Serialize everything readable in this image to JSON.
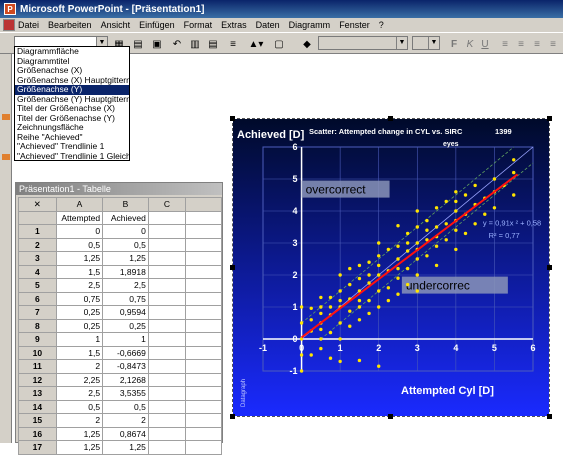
{
  "window": {
    "title": "Microsoft PowerPoint - [Präsentation1]"
  },
  "menu": [
    "Datei",
    "Bearbeiten",
    "Ansicht",
    "Einfügen",
    "Format",
    "Extras",
    "Daten",
    "Diagramm",
    "Fenster",
    "?"
  ],
  "toolbar": {
    "font_buttons": [
      "F",
      "K",
      "U"
    ],
    "element_combo_value": ""
  },
  "dropdown": {
    "options": [
      "Diagrammfläche",
      "Diagrammtitel",
      "Größenachse (X)",
      "Größenachse (X) Hauptgitternetz",
      "Größenachse (Y)",
      "Größenachse (Y) Hauptgitternetz",
      "Titel der Größenachse (X)",
      "Titel der Größenachse (Y)",
      "Zeichnungsfläche",
      "Reihe \"Achieved\"",
      "\"Achieved\" Trendlinie 1",
      "\"Achieved\" Trendlinie 1 Gleichung"
    ],
    "selected_index": 4
  },
  "datasheet": {
    "title": "Präsentation1 - Tabelle",
    "columns": [
      "A",
      "B",
      "C"
    ],
    "header_row": [
      "Attempted",
      "Achieved",
      "",
      ""
    ],
    "rows": [
      [
        "1",
        "0",
        "0"
      ],
      [
        "2",
        "0,5",
        "0,5"
      ],
      [
        "3",
        "1,25",
        "1,25"
      ],
      [
        "4",
        "1,5",
        "1,8918"
      ],
      [
        "5",
        "2,5",
        "2,5"
      ],
      [
        "6",
        "0,75",
        "0,75"
      ],
      [
        "7",
        "0,25",
        "0,9594"
      ],
      [
        "8",
        "0,25",
        "0,25"
      ],
      [
        "9",
        "1",
        "1"
      ],
      [
        "10",
        "1,5",
        "-0,6669"
      ],
      [
        "11",
        "2",
        "-0,8473"
      ],
      [
        "12",
        "2,25",
        "2,1268"
      ],
      [
        "13",
        "2,5",
        "3,5355"
      ],
      [
        "14",
        "0,5",
        "0,5"
      ],
      [
        "15",
        "2",
        "2"
      ],
      [
        "16",
        "1,25",
        "0,8674"
      ],
      [
        "17",
        "1,25",
        "1,25"
      ]
    ]
  },
  "chart_data": {
    "type": "scatter",
    "title": "Scatter: Attempted change in CYL vs. SIRC",
    "title_count": "1399",
    "title_unit": "eyes",
    "xlabel": "Attempted Cyl [D]",
    "ylabel": "Achieved [D]",
    "xlim": [
      -1,
      6
    ],
    "ylim": [
      -1,
      6
    ],
    "x_ticks": [
      "-1",
      "0",
      "1",
      "2",
      "3",
      "4",
      "5",
      "6"
    ],
    "y_ticks": [
      "-1",
      "0",
      "1",
      "2",
      "3",
      "4",
      "5",
      "6"
    ],
    "grid": true,
    "annotations": {
      "overcorrect": "overcorrect",
      "undercorrect": "undercorrec",
      "equation": "y = 0,91x    ² + 0,58",
      "r2": "R² = 0,77",
      "brand": "Datagraph"
    },
    "trendline": {
      "slope": 0.91,
      "intercept": 0.05,
      "x_range": [
        0,
        5.6
      ]
    },
    "series": [
      {
        "name": "Achieved",
        "points": [
          [
            0,
            0
          ],
          [
            0,
            -0.5
          ],
          [
            0,
            0.5
          ],
          [
            0,
            1
          ],
          [
            0,
            -1
          ],
          [
            0.25,
            0.25
          ],
          [
            0.25,
            0.96
          ],
          [
            0.25,
            -0.5
          ],
          [
            0.25,
            0.6
          ],
          [
            0.5,
            0.5
          ],
          [
            0.5,
            0
          ],
          [
            0.5,
            1
          ],
          [
            0.5,
            -0.3
          ],
          [
            0.5,
            0.8
          ],
          [
            0.5,
            1.3
          ],
          [
            0.75,
            0.75
          ],
          [
            0.75,
            0.2
          ],
          [
            0.75,
            1.3
          ],
          [
            0.75,
            -0.6
          ],
          [
            1,
            1
          ],
          [
            1,
            0.5
          ],
          [
            1,
            1.5
          ],
          [
            1,
            0
          ],
          [
            1,
            2
          ],
          [
            1,
            -0.7
          ],
          [
            1.25,
            1.25
          ],
          [
            1.25,
            0.87
          ],
          [
            1.25,
            1.7
          ],
          [
            1.25,
            0.4
          ],
          [
            1.25,
            2.2
          ],
          [
            1.5,
            1.89
          ],
          [
            1.5,
            -0.67
          ],
          [
            1.5,
            1.5
          ],
          [
            1.5,
            1
          ],
          [
            1.5,
            2.3
          ],
          [
            1.5,
            0.6
          ],
          [
            1.75,
            1.75
          ],
          [
            1.75,
            1.2
          ],
          [
            1.75,
            2.4
          ],
          [
            1.75,
            0.8
          ],
          [
            2,
            2
          ],
          [
            2,
            -0.85
          ],
          [
            2,
            1.5
          ],
          [
            2,
            2.6
          ],
          [
            2,
            1
          ],
          [
            2,
            3
          ],
          [
            2.25,
            2.13
          ],
          [
            2.25,
            1.6
          ],
          [
            2.25,
            2.8
          ],
          [
            2.25,
            1.2
          ],
          [
            2.5,
            2.5
          ],
          [
            2.5,
            3.54
          ],
          [
            2.5,
            1.9
          ],
          [
            2.5,
            2.9
          ],
          [
            2.5,
            1.4
          ],
          [
            2.75,
            2.75
          ],
          [
            2.75,
            2.2
          ],
          [
            2.75,
            3.3
          ],
          [
            2.75,
            1.7
          ],
          [
            3,
            3
          ],
          [
            3,
            2.5
          ],
          [
            3,
            3.5
          ],
          [
            3,
            2
          ],
          [
            3,
            4
          ],
          [
            3,
            1.5
          ],
          [
            3.25,
            3.1
          ],
          [
            3.25,
            2.6
          ],
          [
            3.25,
            3.7
          ],
          [
            3.5,
            3.5
          ],
          [
            3.5,
            2.9
          ],
          [
            3.5,
            4.1
          ],
          [
            3.5,
            2.3
          ],
          [
            3.75,
            3.6
          ],
          [
            3.75,
            3.1
          ],
          [
            3.75,
            4.3
          ],
          [
            4,
            4
          ],
          [
            4,
            3.4
          ],
          [
            4,
            4.6
          ],
          [
            4,
            2.8
          ],
          [
            4,
            3.7
          ],
          [
            4.25,
            3.9
          ],
          [
            4.25,
            4.5
          ],
          [
            4.25,
            3.3
          ],
          [
            4.5,
            4.2
          ],
          [
            4.5,
            4.8
          ],
          [
            4.5,
            3.6
          ],
          [
            4.75,
            4.4
          ],
          [
            4.75,
            3.9
          ],
          [
            5,
            4.6
          ],
          [
            5,
            5
          ],
          [
            5,
            4.1
          ],
          [
            5.25,
            4.8
          ],
          [
            5.5,
            5.2
          ],
          [
            5.5,
            4.5
          ],
          [
            5.5,
            5.6
          ],
          [
            2.5,
            2.2
          ],
          [
            1,
            1.2
          ],
          [
            0.5,
            0.3
          ],
          [
            3,
            2.8
          ],
          [
            2,
            2.3
          ],
          [
            1.5,
            1.2
          ],
          [
            3.5,
            3.2
          ],
          [
            4,
            4.3
          ],
          [
            2.75,
            3
          ],
          [
            1.75,
            2
          ],
          [
            0.75,
            1
          ],
          [
            3.25,
            3.4
          ]
        ]
      }
    ]
  }
}
